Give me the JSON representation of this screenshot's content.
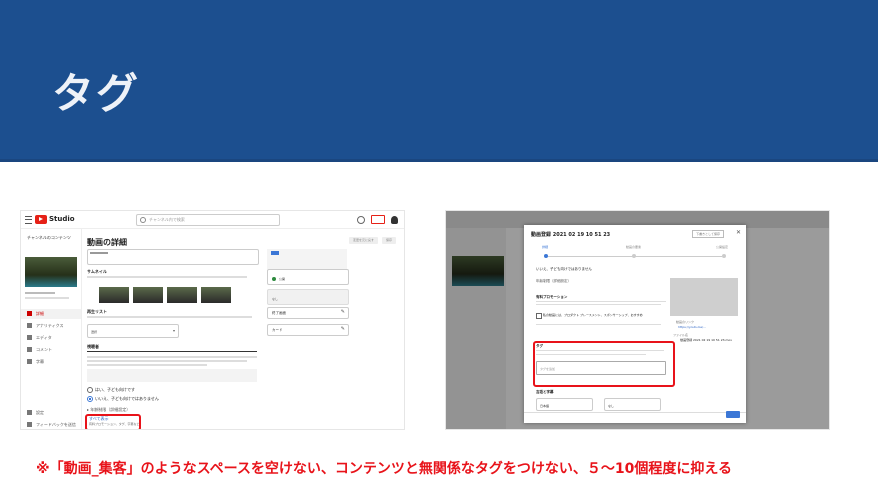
{
  "slide": {
    "title": "タグ",
    "note": "※「動画_集客」のようなスペースを空けない、コンテンツと無関係なタグをつけない、５〜10個程度に抑える"
  },
  "left_screenshot": {
    "app_name": "Studio",
    "search_placeholder": "チャンネル内で検索",
    "page_title": "動画の詳細",
    "buttons": [
      "変更を元に戻す",
      "保存"
    ],
    "channel_label": "チャンネルのコンテンツ",
    "sidebar_items": [
      "詳細",
      "アナリティクス",
      "エディタ",
      "コメント",
      "字幕"
    ],
    "sidebar_bottom": [
      "設定",
      "フィードバックを送信"
    ],
    "thumbnail_heading": "サムネイル",
    "playlist_heading": "再生リスト",
    "playlist_value": "選択",
    "audience_heading": "視聴者",
    "radio_yes": "はい、子ども向けです",
    "radio_no": "いいえ、子ども向けではありません",
    "more_options": "その他のオプション",
    "tags_link": "すべて表示",
    "tags_caption": "有料プロモーション、タグ、字幕など",
    "visibility_value": "公開",
    "end_screen": "終了画面",
    "cards": "カード",
    "caption_default": "なし"
  },
  "right_screenshot": {
    "dialog_title": "動画登録 2021 02 19 10 51 23",
    "draft_button": "下書きとして保存",
    "steps": [
      "詳細",
      "動画の要素",
      "公開設定"
    ],
    "audience_note": "いいえ、子ども向けではありません",
    "age_restriction": "年齢制限（詳細設定）",
    "paid_promo_heading": "有料プロモーション",
    "paid_promo_checkbox": "私の動画には、プロダクト プレースメント、スポンサーシップ、おすすめ",
    "tags_heading": "タグ",
    "tags_placeholder": "タグを追加",
    "language_heading": "言語と字幕",
    "video_link_label": "動画のリンク",
    "filename_label": "ファイル名",
    "filename_value": "動画登録 2021 02 19 10 51 23.mov",
    "language_value": "日本語",
    "caption_value": "なし"
  },
  "colors": {
    "header_bg": "#1c4f8f",
    "title_text": "#eef2f8",
    "note_text": "#e8131a",
    "highlight_border": "#e8131a",
    "youtube_red": "#e62117",
    "primary_blue": "#3b77d6"
  }
}
